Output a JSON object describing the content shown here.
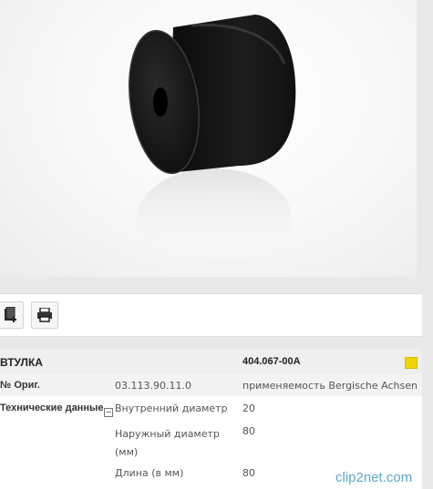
{
  "product": {
    "name": "ВТУЛКА",
    "code": "404.067-00A",
    "orig_label": "№ Ориг.",
    "orig_number": "03.113.90.11.0",
    "applicability": "применяемость Bergische Achsen",
    "tech_label": "Технические данные",
    "specs": [
      {
        "name": "Внутренний диаметр",
        "value": "20"
      },
      {
        "name": "Наружный диаметр (мм)",
        "value": "80"
      },
      {
        "name": "Длина (в мм)",
        "value": "80"
      }
    ]
  },
  "toolbar": {
    "buttons": [
      {
        "icon": "add-to-notepad-icon"
      },
      {
        "icon": "printer-icon"
      }
    ]
  },
  "watermark": {
    "text": "clip2net.com"
  },
  "colors": {
    "flag": "#f2d500",
    "header_bg": "#efefef"
  }
}
